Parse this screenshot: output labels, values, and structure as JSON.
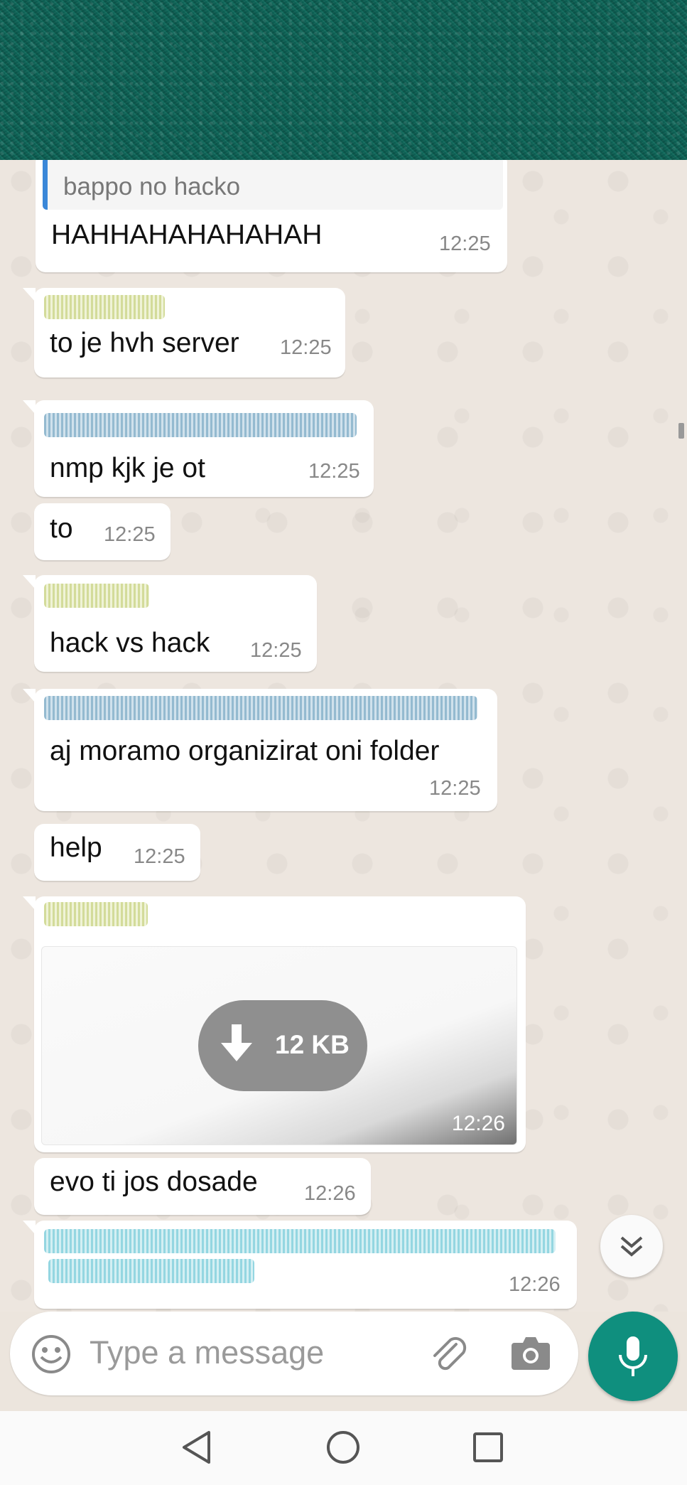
{
  "header": {
    "redacted": true
  },
  "messages": [
    {
      "quote": "bappo no hacko",
      "text": "HAHHAHAHAHAHAH",
      "time": "12:25"
    },
    {
      "sender": "redacted",
      "text": "to je hvh server",
      "time": "12:25"
    },
    {
      "sender": "redacted",
      "text": "nmp kjk je ot",
      "time": "12:25"
    },
    {
      "text": "to",
      "time": "12:25"
    },
    {
      "sender": "redacted",
      "text": "hack vs hack",
      "time": "12:25"
    },
    {
      "sender": "redacted",
      "text": "aj moramo organizirat oni folder",
      "time": "12:25"
    },
    {
      "text": "help",
      "time": "12:25"
    },
    {
      "sender": "redacted",
      "attachment": {
        "size": "12 KB"
      },
      "time": "12:26"
    },
    {
      "text": "evo ti jos dosade",
      "time": "12:26"
    },
    {
      "sender": "redacted",
      "text": "redacted",
      "time": "12:26"
    }
  ],
  "input": {
    "placeholder": "Type a message"
  },
  "icons": {
    "emoji": "emoji-icon",
    "attach": "paperclip-icon",
    "camera": "camera-icon",
    "mic": "mic-icon",
    "scroll": "chevron-double-down-icon",
    "nav_back": "back-triangle-icon",
    "nav_home": "home-circle-icon",
    "nav_recent": "recent-square-icon"
  },
  "colors": {
    "header": "#0d5e52",
    "quote_bar": "#3a87d8",
    "mic_button": "#0f8f7e",
    "chat_bg": "#ede6df"
  }
}
